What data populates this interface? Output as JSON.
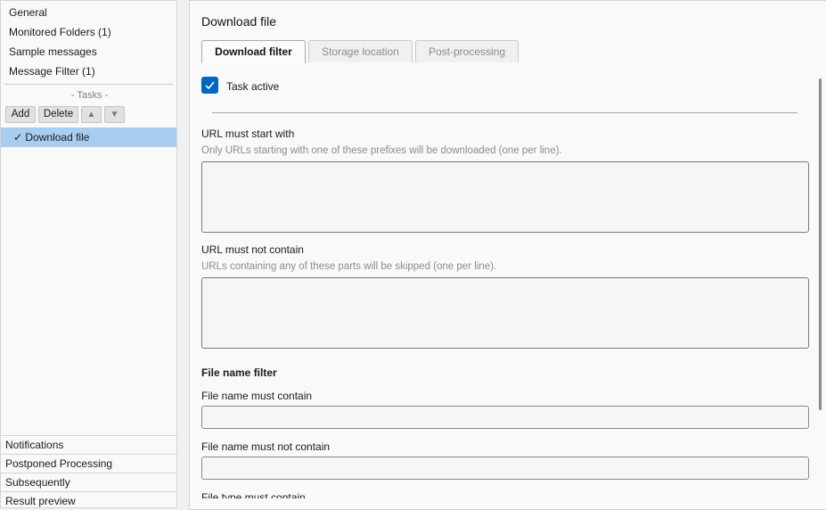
{
  "sidebar": {
    "items": [
      "General",
      "Monitored Folders (1)",
      "Sample messages",
      "Message Filter (1)"
    ],
    "tasks_label": "- Tasks -",
    "buttons": {
      "add": "Add",
      "delete": "Delete",
      "up": "▲",
      "down": "▼"
    },
    "selected_task": "✓ Download file",
    "bottom_items": [
      "Notifications",
      "Postponed Processing",
      "Subsequently",
      "Result preview"
    ]
  },
  "main": {
    "title": "Download file",
    "tabs": [
      "Download filter",
      "Storage location",
      "Post-processing"
    ],
    "task_active_label": "Task active",
    "task_active_checked": true,
    "url_start": {
      "label": "URL must start with",
      "hint": "Only URLs starting with one of these prefixes will be downloaded (one per line).",
      "value": ""
    },
    "url_not_contain": {
      "label": "URL must not contain",
      "hint": "URLs containing any of these parts will be skipped (one per line).",
      "value": ""
    },
    "file_name_filter_heading": "File name filter",
    "file_name_contain": {
      "label": "File name must contain",
      "value": ""
    },
    "file_name_not_contain": {
      "label": "File name must not contain",
      "value": ""
    },
    "file_type_contain": {
      "label": "File type must contain"
    }
  },
  "colors": {
    "accent": "#0067c0",
    "selection": "#a9cdf0"
  }
}
